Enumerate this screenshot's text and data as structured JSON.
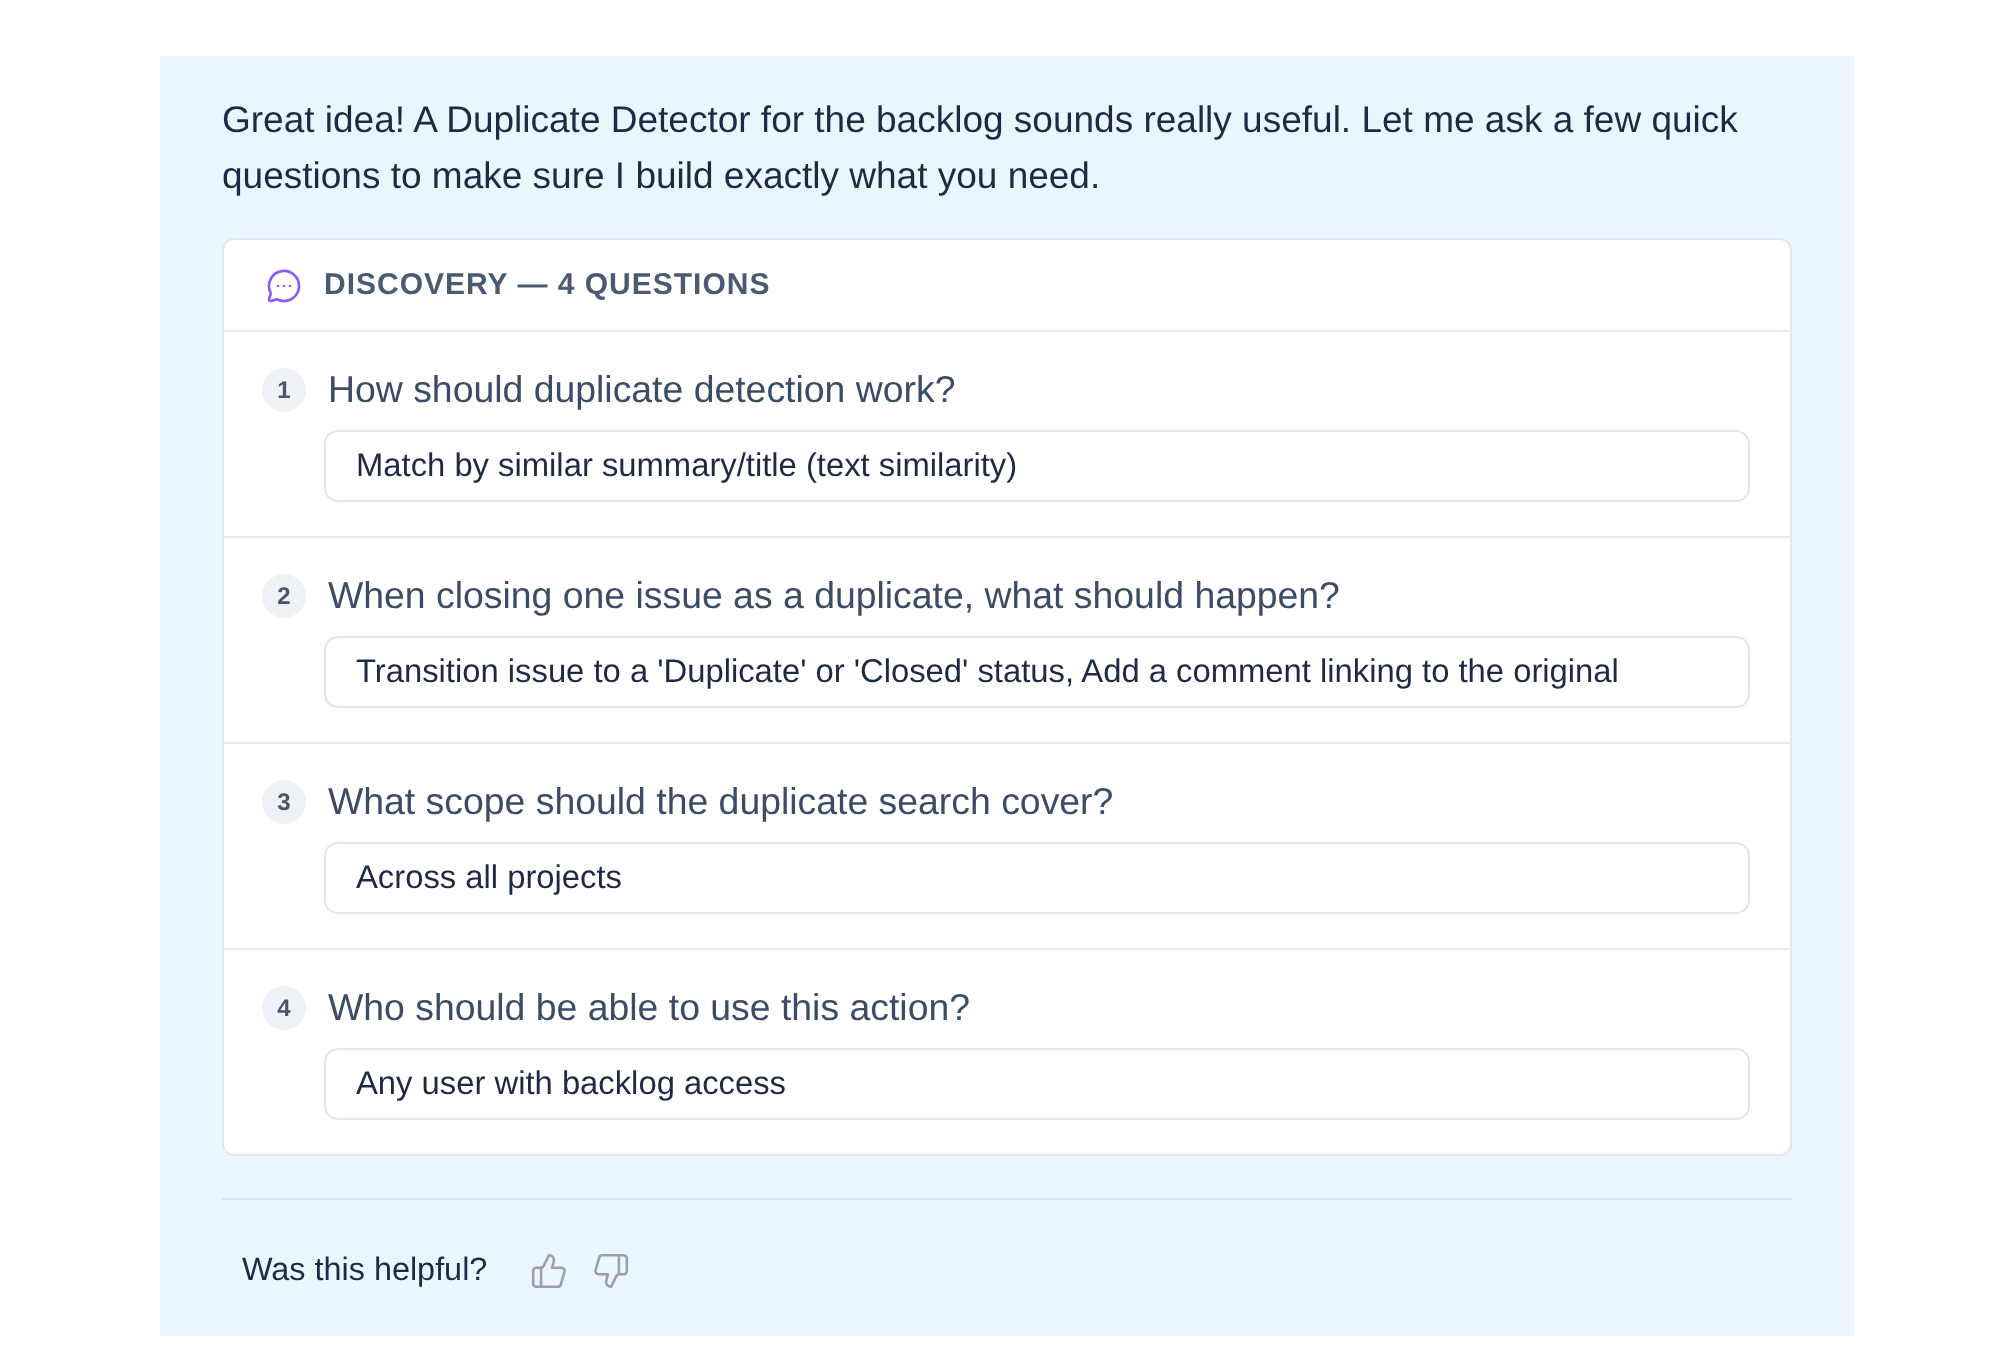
{
  "message": {
    "text": "Great idea! A Duplicate Detector for the backlog sounds really useful. Let me ask a few quick questions to make sure I build exactly what you need."
  },
  "discovery": {
    "title": "DISCOVERY — 4 QUESTIONS",
    "questions": [
      {
        "number": "1",
        "question": "How should duplicate detection work?",
        "answer": "Match by similar summary/title (text similarity)"
      },
      {
        "number": "2",
        "question": "When closing one issue as a duplicate, what should happen?",
        "answer": "Transition issue to a 'Duplicate' or 'Closed' status, Add a comment linking to the original"
      },
      {
        "number": "3",
        "question": "What scope should the duplicate search cover?",
        "answer": "Across all projects"
      },
      {
        "number": "4",
        "question": "Who should be able to use this action?",
        "answer": "Any user with backlog access"
      }
    ]
  },
  "feedback": {
    "prompt": "Was this helpful?"
  }
}
